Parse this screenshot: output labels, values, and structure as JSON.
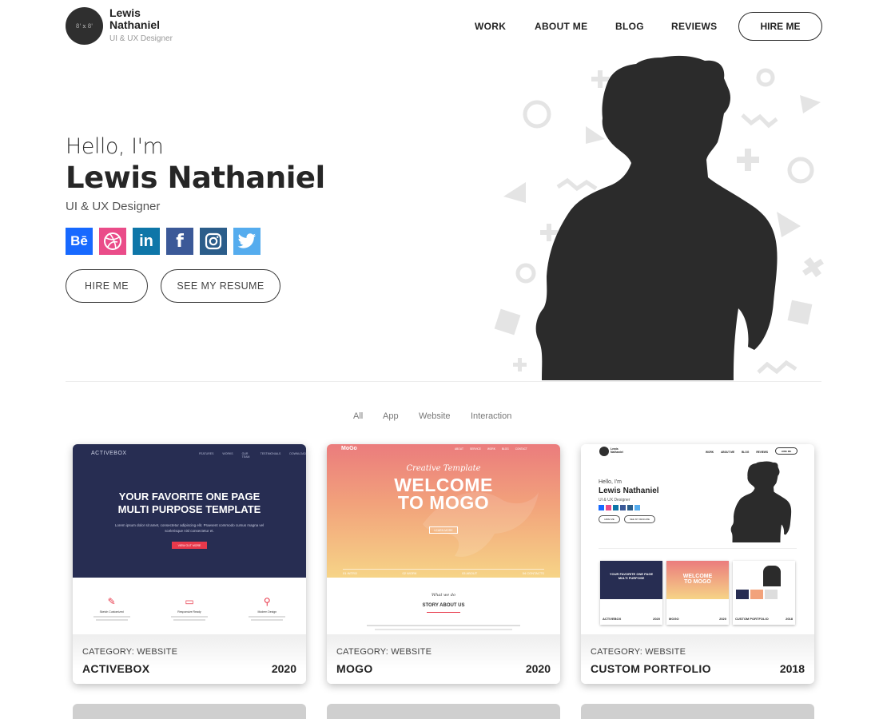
{
  "header": {
    "logo_badge": "8' x 8'",
    "name": "Lewis Nathaniel",
    "role": "UI & UX Designer",
    "nav": [
      "WORK",
      "ABOUT ME",
      "BLOG",
      "REVIEWS"
    ],
    "hire_label": "HIRE ME"
  },
  "hero": {
    "greeting": "Hello, I'm",
    "name": "Lewis Nathaniel",
    "role": "UI & UX Designer",
    "social": [
      {
        "icon": "behance-icon",
        "glyph": "Bē",
        "color": "#1769ff"
      },
      {
        "icon": "dribbble-icon",
        "glyph": "◎",
        "color": "#ea4c89"
      },
      {
        "icon": "linkedin-icon",
        "glyph": "in",
        "color": "#0e76a8"
      },
      {
        "icon": "facebook-icon",
        "glyph": "f",
        "color": "#3b5998"
      },
      {
        "icon": "instagram-icon",
        "glyph": "◙",
        "color": "#2b5d8a"
      },
      {
        "icon": "twitter-icon",
        "glyph": "🐦",
        "color": "#55acee"
      }
    ],
    "hire_label": "HIRE ME",
    "resume_label": "SEE MY RESUME"
  },
  "filters": [
    "All",
    "App",
    "Website",
    "Interaction"
  ],
  "cards": [
    {
      "category": "CATEGORY: WEBSITE",
      "title": "ACTIVEBOX",
      "year": "2020",
      "preview": {
        "brand": "ACTIVEBOX",
        "nav": [
          "FEATURES",
          "WORKS",
          "OUR TEAM",
          "TESTIMONIALS",
          "DOWNLOAD"
        ],
        "headline_1": "YOUR FAVORITE ONE PAGE",
        "headline_2": "MULTI PURPOSE TEMPLATE",
        "body_1": "Lorem ipsum dolor sit amet, consectetur adipiscing elit. Praesent commodo cursus magna vel",
        "body_2": "scelerisque nisl consectetur et.",
        "cta": "VIEW OUT MORE",
        "features": [
          "Sketch Customized",
          "Responsive Ready",
          "Modern Design"
        ]
      }
    },
    {
      "category": "CATEGORY: WEBSITE",
      "title": "MOGO",
      "year": "2020",
      "preview": {
        "brand": "MoGo",
        "nav": [
          "ABOUT",
          "SERVICE",
          "WORK",
          "BLOG",
          "CONTACT"
        ],
        "script": "Creative Template",
        "headline_1": "WELCOME",
        "headline_2": "TO MOGO",
        "cta": "LEARN MORE",
        "stats": [
          "01 INTRO",
          "02 WORK",
          "03 ABOUT",
          "04 CONTACTS"
        ],
        "section_script": "What we do",
        "section_title": "STORY ABOUT US"
      }
    },
    {
      "category": "CATEGORY: WEBSITE",
      "title": "CUSTOM PORTFOLIO",
      "year": "2018",
      "preview": {
        "name": "Lewis Nathaniel",
        "nav": [
          "WORK",
          "ABOUT ME",
          "BLOG",
          "REVIEWS"
        ],
        "hire": "HIRE ME",
        "greeting": "Hello, I'm",
        "role": "UI & UX Designer",
        "btn_hire": "HIRE ME",
        "btn_resume": "SEE MY RESUME",
        "mini_titles": [
          "ACTIVEBOX",
          "MOGO",
          "CUSTOM PORTFOLIO"
        ],
        "mini_years": [
          "2020",
          "2020",
          "2018"
        ]
      }
    }
  ],
  "colors": {
    "dark": "#2a2a2a",
    "activebox_bg": "#262c4f",
    "mogo_top": "#ea7b7c",
    "mogo_bottom": "#f5d27f",
    "red_accent": "#e8394b"
  }
}
